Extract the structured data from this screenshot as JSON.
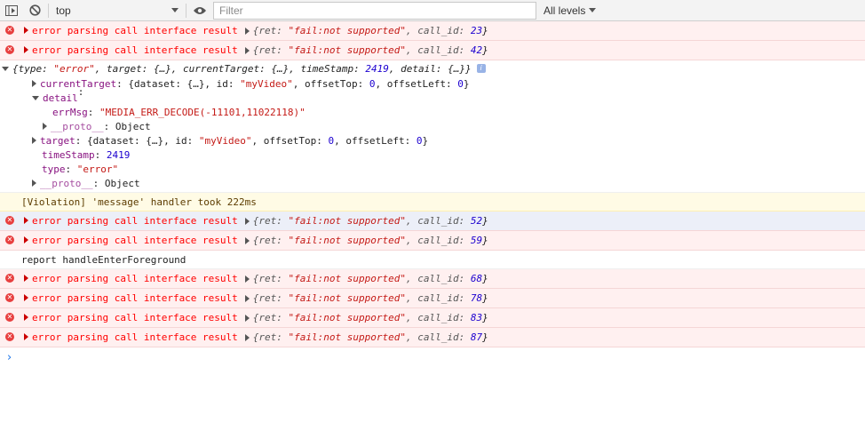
{
  "toolbar": {
    "context": "top",
    "filter_placeholder": "Filter",
    "levels_label": "All levels"
  },
  "errors_top": [
    {
      "msg": "error parsing call interface result",
      "ret": "\"fail:not supported\"",
      "call_id": "23"
    },
    {
      "msg": "error parsing call interface result",
      "ret": "\"fail:not supported\"",
      "call_id": "42"
    }
  ],
  "object": {
    "summary_a": "{type: ",
    "summary_type": "\"error\"",
    "summary_b": ", target: {…}, currentTarget: {…}, timeStamp: ",
    "summary_ts": "2419",
    "summary_c": ", detail: {…}}",
    "currentTarget_key": "currentTarget",
    "currentTarget_a": "{dataset: {…}, id: ",
    "currentTarget_id": "\"myVideo\"",
    "currentTarget_b": ", offsetTop: ",
    "currentTarget_top": "0",
    "currentTarget_c": ", offsetLeft: ",
    "currentTarget_left": "0",
    "currentTarget_d": "}",
    "detail_key": "detail",
    "errMsg_key": "errMsg",
    "errMsg_val": "\"MEDIA_ERR_DECODE(-11101,11022118)\"",
    "proto_key": "__proto__",
    "proto_val": "Object",
    "target_key": "target",
    "target_a": "{dataset: {…}, id: ",
    "target_id": "\"myVideo\"",
    "target_b": ", offsetTop: ",
    "target_top": "0",
    "target_c": ", offsetLeft: ",
    "target_left": "0",
    "target_d": "}",
    "timeStamp_key": "timeStamp",
    "timeStamp_val": "2419",
    "type_key": "type",
    "type_val": "\"error\"",
    "proto2_key": "__proto__",
    "proto2_val": "Object"
  },
  "violation": "[Violation] 'message' handler took 222ms",
  "errors_mid": [
    {
      "msg": "error parsing call interface result",
      "ret": "\"fail:not supported\"",
      "call_id": "52"
    },
    {
      "msg": "error parsing call interface result",
      "ret": "\"fail:not supported\"",
      "call_id": "59"
    }
  ],
  "log_line": "report handleEnterForeground",
  "errors_bottom": [
    {
      "msg": "error parsing call interface result",
      "ret": "\"fail:not supported\"",
      "call_id": "68"
    },
    {
      "msg": "error parsing call interface result",
      "ret": "\"fail:not supported\"",
      "call_id": "78"
    },
    {
      "msg": "error parsing call interface result",
      "ret": "\"fail:not supported\"",
      "call_id": "83"
    },
    {
      "msg": "error parsing call interface result",
      "ret": "\"fail:not supported\"",
      "call_id": "87"
    }
  ],
  "labels": {
    "ret_key": "{ret: ",
    "sep": ", ",
    "call_key": "call_id: ",
    "close": "}"
  },
  "prompt": "›"
}
